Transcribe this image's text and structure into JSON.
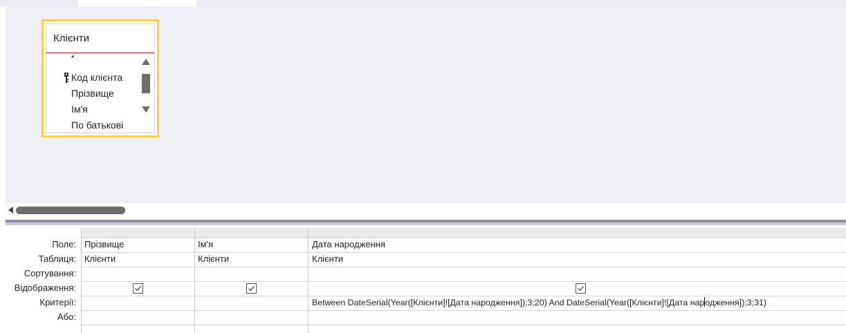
{
  "table": {
    "title": "Клієнти",
    "fields": [
      "*",
      "Код клієнта",
      "Прізвище",
      "Ім'я",
      "По батькові"
    ]
  },
  "grid": {
    "row_labels": [
      "Поле:",
      "Таблиця:",
      "Сортування:",
      "Відображення:",
      "Критерії:",
      "Або:"
    ],
    "columns": [
      {
        "field": "Прізвище",
        "table": "Клієнти",
        "show": true,
        "criteria": ""
      },
      {
        "field": "Ім'я",
        "table": "Клієнти",
        "show": true,
        "criteria": ""
      },
      {
        "field": "Дата народження",
        "table": "Клієнти",
        "show": true,
        "criteria_before_caret": "Between DateSerial(Year([Клієнти]![Дата народження]);3;20) And DateSerial(Year([Клієнти]![Дата нар",
        "criteria_after_caret": "одження]);3;31)"
      }
    ]
  }
}
